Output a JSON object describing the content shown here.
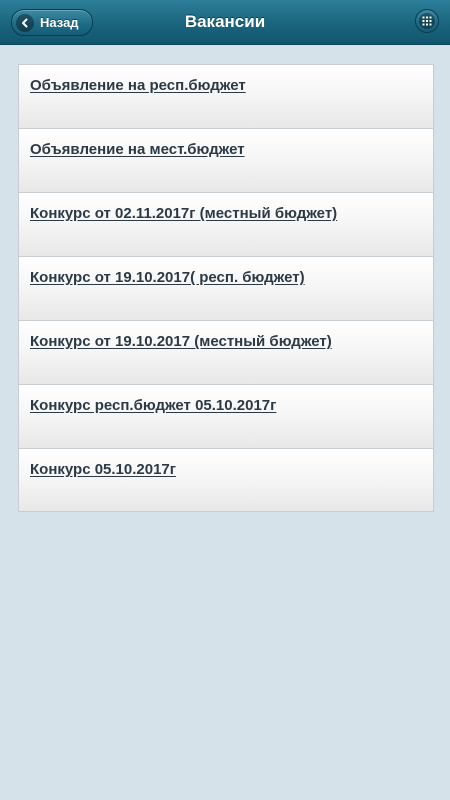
{
  "header": {
    "back_label": "Назад",
    "title": "Вакансии",
    "back_icon": "chevron-left-icon",
    "menu_icon": "grid-icon"
  },
  "colors": {
    "header": "#1c6680",
    "background": "#d6e2ea",
    "link": "#2c3a46"
  },
  "vacancies": {
    "items": [
      {
        "label": "Объявление на респ.бюджет"
      },
      {
        "label": "Объявление на мест.бюджет"
      },
      {
        "label": "Конкурс от 02.11.2017г (местный бюджет)"
      },
      {
        "label": "Конкурс от 19.10.2017( респ. бюджет)"
      },
      {
        "label": "Конкурс от 19.10.2017 (местный бюджет)"
      },
      {
        "label": "Конкурс респ.бюджет 05.10.2017г"
      },
      {
        "label": "Конкурс 05.10.2017г"
      }
    ]
  }
}
